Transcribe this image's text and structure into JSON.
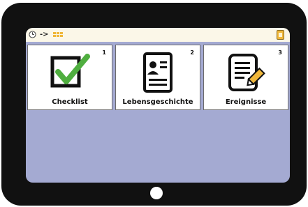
{
  "topbar": {
    "clock_icon": "clock-icon",
    "arrow": "->",
    "grid_icon": "grid-icon",
    "category_icon": "category-icon"
  },
  "tiles": [
    {
      "number": "1",
      "label": "Checklist",
      "icon": "checklist-icon"
    },
    {
      "number": "2",
      "label": "Lebensgeschichte",
      "icon": "profile-document-icon"
    },
    {
      "number": "3",
      "label": "Ereignisse",
      "icon": "notes-pencil-icon"
    }
  ],
  "colors": {
    "frame": "#111111",
    "screen_bg": "#a4aad2",
    "topbar_bg": "#fbf7e8",
    "check_green": "#4fae3f",
    "accent_yellow": "#f0b73a"
  }
}
